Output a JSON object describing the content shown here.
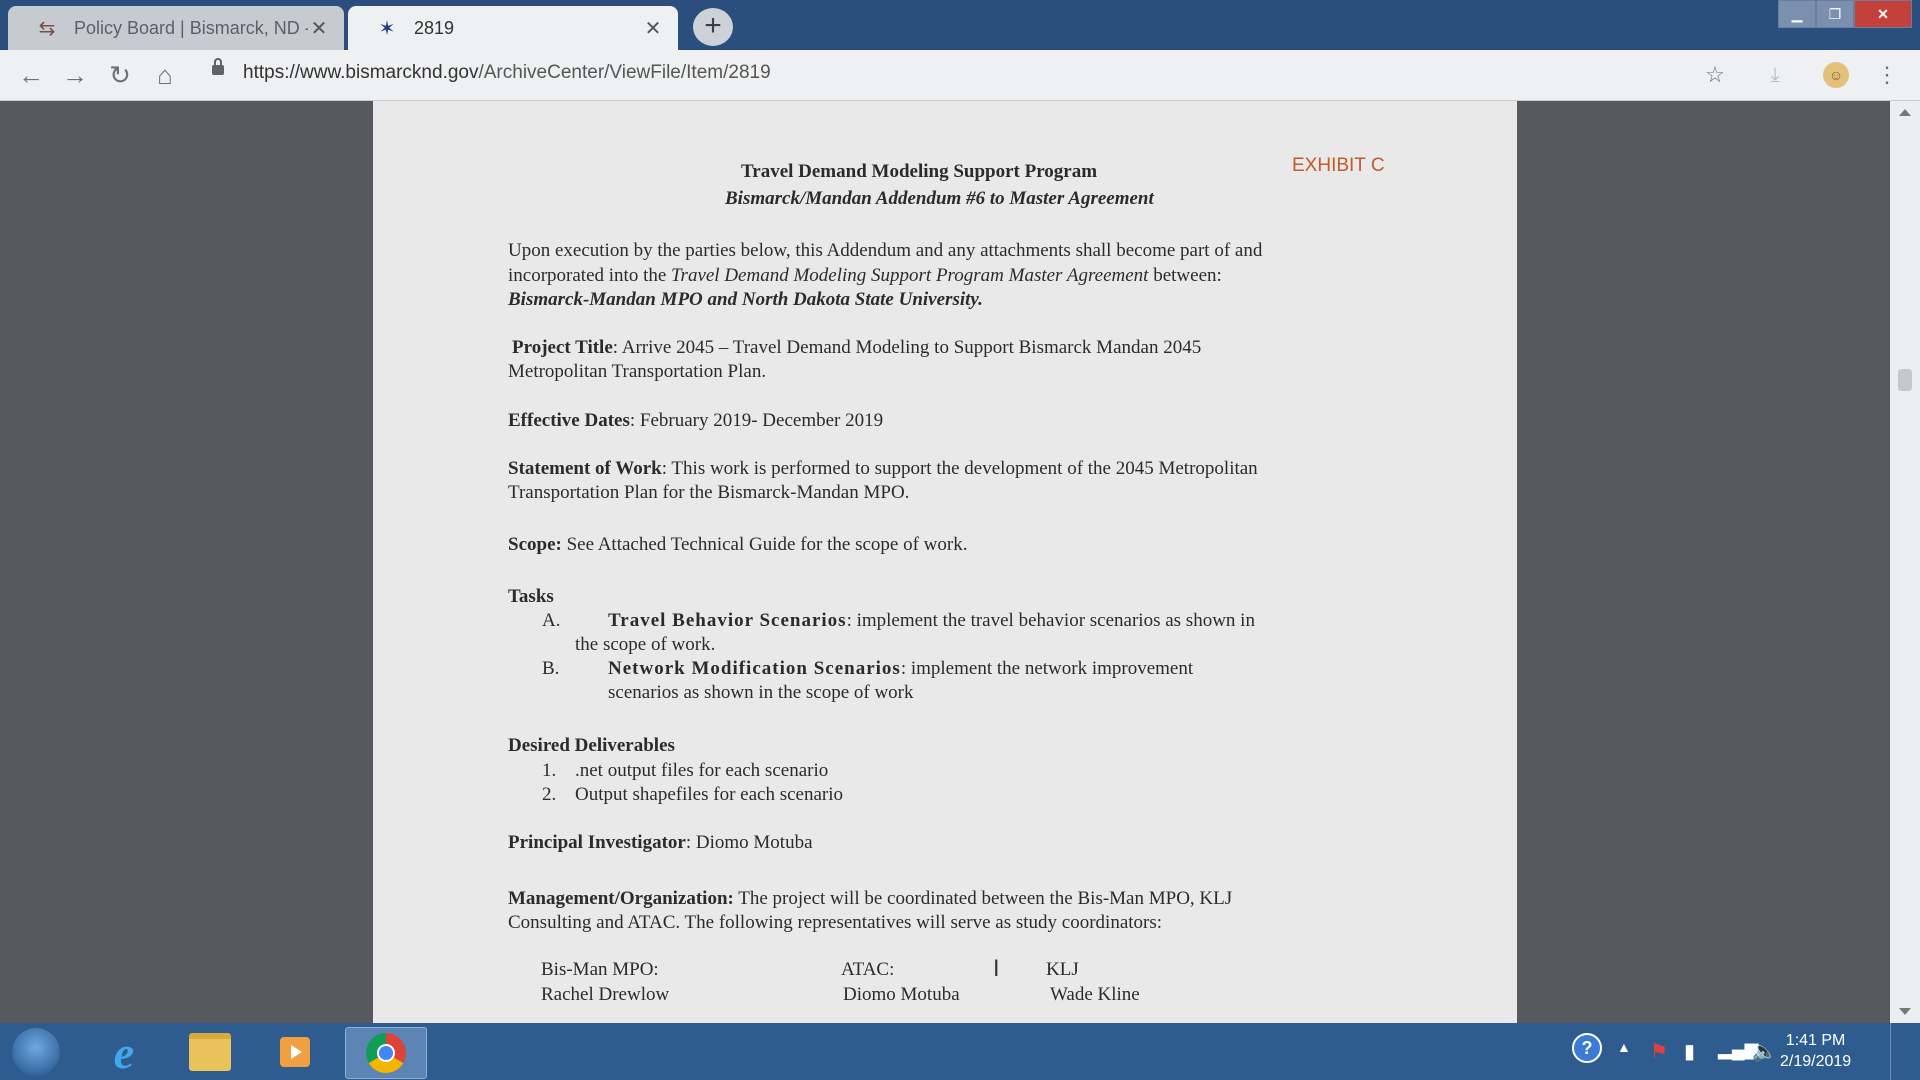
{
  "browser": {
    "tabs": [
      {
        "title": "Policy Board | Bismarck, ND - Offi",
        "favicon": "link-icon",
        "active": false
      },
      {
        "title": "2819",
        "favicon": "star-figure-icon",
        "active": true
      }
    ],
    "url_host": "https://www.bismarcknd.gov",
    "url_path": "/ArchiveCenter/ViewFile/Item/2819"
  },
  "document": {
    "title": "Travel Demand Modeling Support Program",
    "subtitle": "Bismarck/Mandan Addendum #6 to Master Agreement",
    "exhibit": "EXHIBIT C",
    "intro_line1": "Upon execution by the parties below, this Addendum and any attachments shall become part of and",
    "intro_line2_pre": "incorporated into the ",
    "intro_line2_italic": "Travel Demand Modeling Support Program Master Agreement",
    "intro_line2_post": " between:",
    "intro_line3": "Bismarck-Mandan MPO and North Dakota State University.",
    "project_title_label": "Project Title",
    "project_title_line1": ":    Arrive 2045 – Travel Demand Modeling to Support Bismarck Mandan 2045",
    "project_title_line2": "Metropolitan Transportation Plan.",
    "effective_dates_label": "Effective Dates",
    "effective_dates_value": ":  February 2019- December 2019",
    "sow_label": "Statement of Work",
    "sow_line1": ": This work is performed to support the development of the 2045 Metropolitan",
    "sow_line2": "Transportation Plan for the Bismarck-Mandan MPO.",
    "scope_label": "Scope:",
    "scope_value": " See Attached Technical Guide for the scope of work.",
    "tasks_heading": "Tasks",
    "tasks": [
      {
        "letter": "A.",
        "label": "Travel Behavior Scenarios",
        "line1": ": implement the travel behavior scenarios as shown in",
        "line2": "the scope of work."
      },
      {
        "letter": "B.",
        "label": "Network Modification Scenarios",
        "line1": ": implement the network improvement",
        "line2": "scenarios as shown in the scope of work"
      }
    ],
    "deliverables_heading": "Desired Deliverables",
    "deliverables": [
      {
        "num": "1.",
        "text": ".net output files for each scenario"
      },
      {
        "num": "2.",
        "text": "Output shapefiles for each scenario"
      }
    ],
    "pi_label": "Principal Investigator",
    "pi_value": ": Diomo Motuba",
    "mgmt_label": "Management/Organization:",
    "mgmt_line1": " The project will be coordinated between the Bis-Man MPO, KLJ",
    "mgmt_line2": "Consulting and ATAC. The following representatives will serve as study coordinators:",
    "coordinators": [
      {
        "org": "Bis-Man MPO:",
        "name": "Rachel Drewlow"
      },
      {
        "org": "ATAC:",
        "name": "Diomo Motuba"
      },
      {
        "org": "KLJ",
        "name": "Wade Kline"
      }
    ]
  },
  "taskbar": {
    "apps": [
      "windows-start-icon",
      "internet-explorer-icon",
      "file-explorer-icon",
      "media-player-icon",
      "chrome-icon"
    ],
    "time": "1:41 PM",
    "date": "2/19/2019"
  }
}
